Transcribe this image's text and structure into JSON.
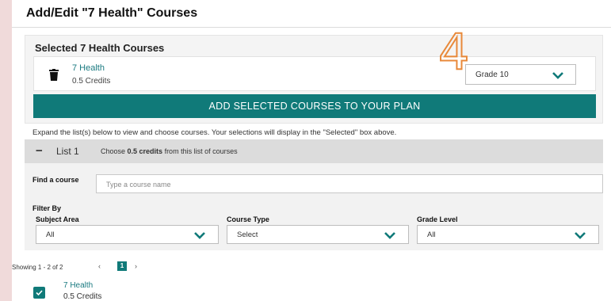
{
  "page": {
    "title": "Add/Edit \"7 Health\" Courses"
  },
  "selected": {
    "title": "Selected 7 Health Courses",
    "course_name": "7 Health",
    "course_credits": "0.5 Credits",
    "grade_value": "Grade 10",
    "annotation": "4",
    "add_button_label": "ADD SELECTED COURSES TO YOUR PLAN"
  },
  "instructions": "Expand the list(s) below to view and choose courses. Your selections will display in the \"Selected\" box above.",
  "list": {
    "toggle": "−",
    "label": "List 1",
    "instr_prefix": "Choose ",
    "instr_bold": "0.5 credits",
    "instr_suffix": " from this list of courses",
    "find_label": "Find a course",
    "find_placeholder": "Type a course name",
    "filter_by": "Filter By",
    "filters": [
      {
        "label": "Subject Area",
        "value": "All"
      },
      {
        "label": "Course Type",
        "value": "Select"
      },
      {
        "label": "Grade Level",
        "value": "All"
      }
    ]
  },
  "pagination": {
    "showing": "Showing 1 - 2 of 2",
    "prev": "‹",
    "current": "1",
    "next": "›"
  },
  "results": [
    {
      "name": "7 Health",
      "credits": "0.5 Credits",
      "checked": true
    }
  ],
  "colors": {
    "accent": "#107a79",
    "link": "#1a7a80",
    "annotation": "#e8893a",
    "page_bg": "#f0dada"
  },
  "icons": {
    "trash": "trash-icon",
    "chevron": "chevron-down-icon",
    "check": "checkmark-icon"
  }
}
